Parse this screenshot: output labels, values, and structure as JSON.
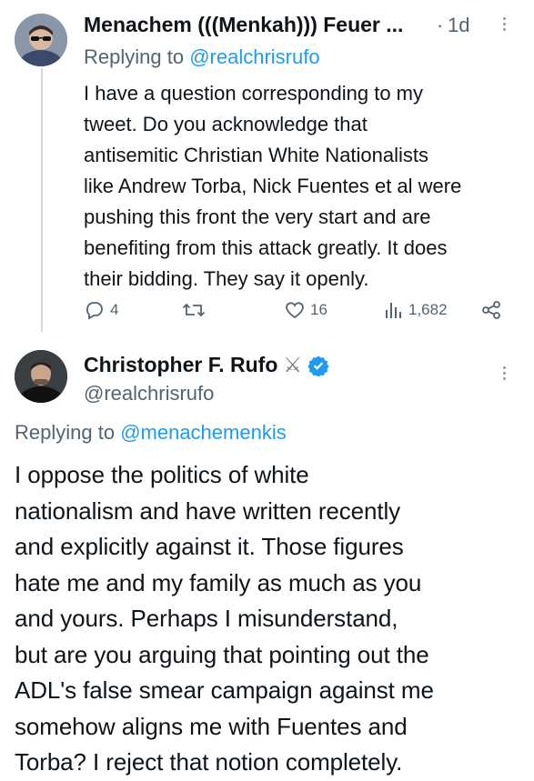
{
  "reply_tweet": {
    "author_name": "Menachem (((Menkah))) Feuer ...",
    "time_sep": "·",
    "time": "1d",
    "replying_prefix": "Replying to ",
    "replying_to": "@realchrisrufo",
    "body_lines": [
      "I have a question corresponding to my",
      "tweet. Do you acknowledge that",
      "antisemitic Christian White Nationalists",
      "like Andrew Torba, Nick Fuentes et al were",
      "pushing this front the very start and are",
      "benefiting from this attack greatly.  It does",
      "their bidding.  They say it openly."
    ],
    "actions": {
      "replies": "4",
      "retweets": "",
      "likes": "16",
      "views": "1,682"
    },
    "icons": [
      "reply-icon",
      "retweet-icon",
      "like-icon",
      "views-icon",
      "share-icon"
    ]
  },
  "main_tweet": {
    "author_name": "Christopher F. Rufo",
    "emoji": "⚔",
    "verified_color": "#1d9bf0",
    "handle": "@realchrisrufo",
    "replying_prefix": "Replying to ",
    "replying_to": "@menachemenkis",
    "body_lines": [
      "I oppose the politics of white",
      "nationalism and have written recently",
      "and explicitly against it. Those figures",
      "hate me and my family as much as you",
      "and yours. Perhaps I misunderstand,",
      "but are you arguing that pointing out the",
      "ADL's false smear campaign against me",
      "somehow aligns me with Fuentes and",
      "Torba? I reject that notion completely."
    ]
  },
  "colors": {
    "link": "#1d9bf0",
    "muted": "#536471",
    "text": "#0f1419"
  }
}
